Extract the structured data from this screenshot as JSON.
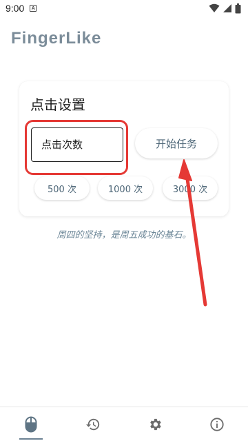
{
  "status_bar": {
    "time": "9:00",
    "notification_letter": "A",
    "icons": [
      "notification-icon",
      "wifi-icon",
      "signal-icon",
      "battery-icon"
    ]
  },
  "app": {
    "title": "FingerLike",
    "title_color": "#7b8c99"
  },
  "card": {
    "title": "点击设置",
    "input_placeholder": "点击次数",
    "input_value": "",
    "start_button_label": "开始任务",
    "presets": [
      "500 次",
      "1000 次",
      "3000 次"
    ]
  },
  "motto": "周四的坚持，是周五成功的基石。",
  "bottom_nav": {
    "items": [
      {
        "icon": "mouse-icon",
        "active": true
      },
      {
        "icon": "history-icon",
        "active": false
      },
      {
        "icon": "settings-icon",
        "active": false
      },
      {
        "icon": "info-icon",
        "active": false
      }
    ]
  },
  "colors": {
    "accent": "#6b8193",
    "annotation_red": "#e53935"
  }
}
